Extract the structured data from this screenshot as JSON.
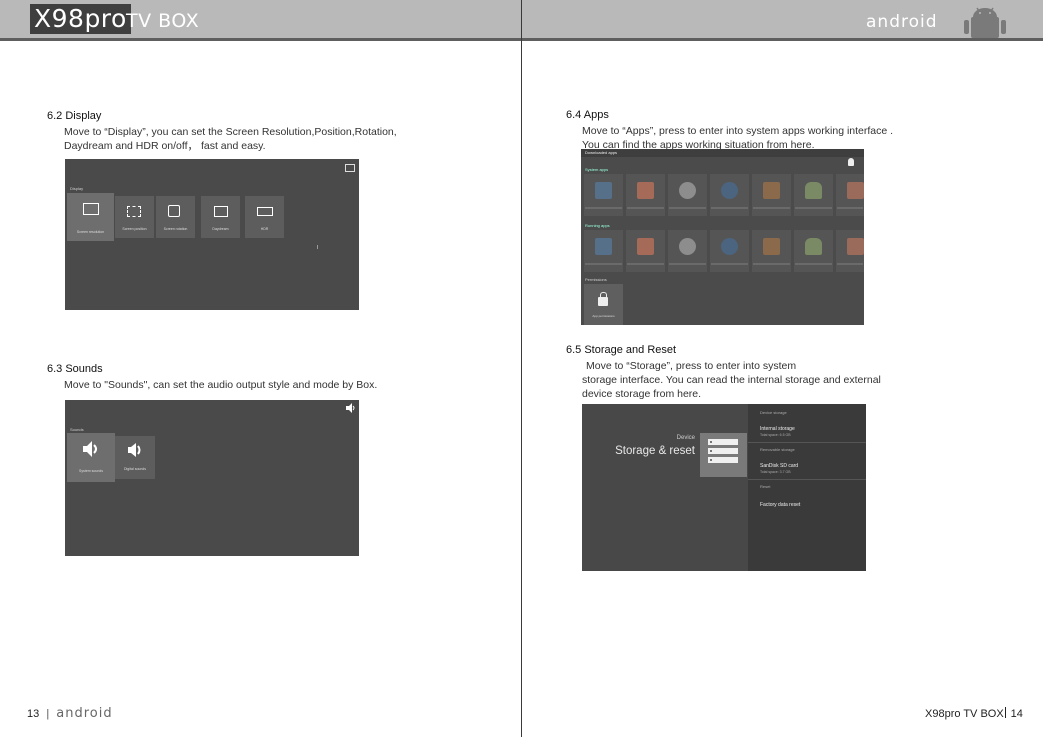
{
  "header": {
    "brand": "X98pro",
    "brand_suffix": "TV BOX",
    "right_text": "android"
  },
  "display": {
    "title": "6.2 Display",
    "body": [
      "Move to “Display”, you can set the Screen Resolution,Position,Rotation,",
      "Daydream and HDR on/off， fast and easy."
    ],
    "screen_label": "Display",
    "tiles": [
      "Screen resolution",
      "Screen position",
      "Screen rotation",
      "Daydream",
      "HDR"
    ],
    "tile_icons": [
      "display-icon",
      "position-icon",
      "rotation-icon",
      "daydream-icon",
      "hdr-icon"
    ]
  },
  "sounds": {
    "title": "6.3 Sounds",
    "body": [
      "Move to \"Sounds\", can set the audio output style and mode by Box."
    ],
    "screen_label": "Sounds",
    "tiles": [
      "System sounds",
      "Digital sounds"
    ]
  },
  "apps": {
    "title": "6.4 Apps",
    "body": [
      "Move to “Apps”, press to enter into system apps working interface .",
      "You can find the apps working situation from here."
    ],
    "screen_header": "Downloaded apps",
    "system_section": "System apps",
    "running_section": "Running apps",
    "permissions_section": "Permissions",
    "permission_tile": "App permissions"
  },
  "storage": {
    "title": "6.5 Storage and Reset",
    "body": [
      "Move to “Storage”, press to enter into system",
      "storage interface. You can read the internal storage and external",
      "device storage from here."
    ],
    "left_small": "Device",
    "left_big": "Storage & reset",
    "right": {
      "device_storage_header": "Device storage",
      "internal_title": "Internal storage",
      "internal_sub": "Total space: 6.5 GB",
      "removable_header": "Removable storage",
      "sd_title": "SanDisk SD card",
      "sd_sub": "Total space: 3.7 GB",
      "reset_header": "Reset",
      "factory_reset": "Factory data reset"
    }
  },
  "footer": {
    "left_page": "13",
    "left_word": "android",
    "right_label": "X98pro TV BOX",
    "right_page": "14"
  }
}
